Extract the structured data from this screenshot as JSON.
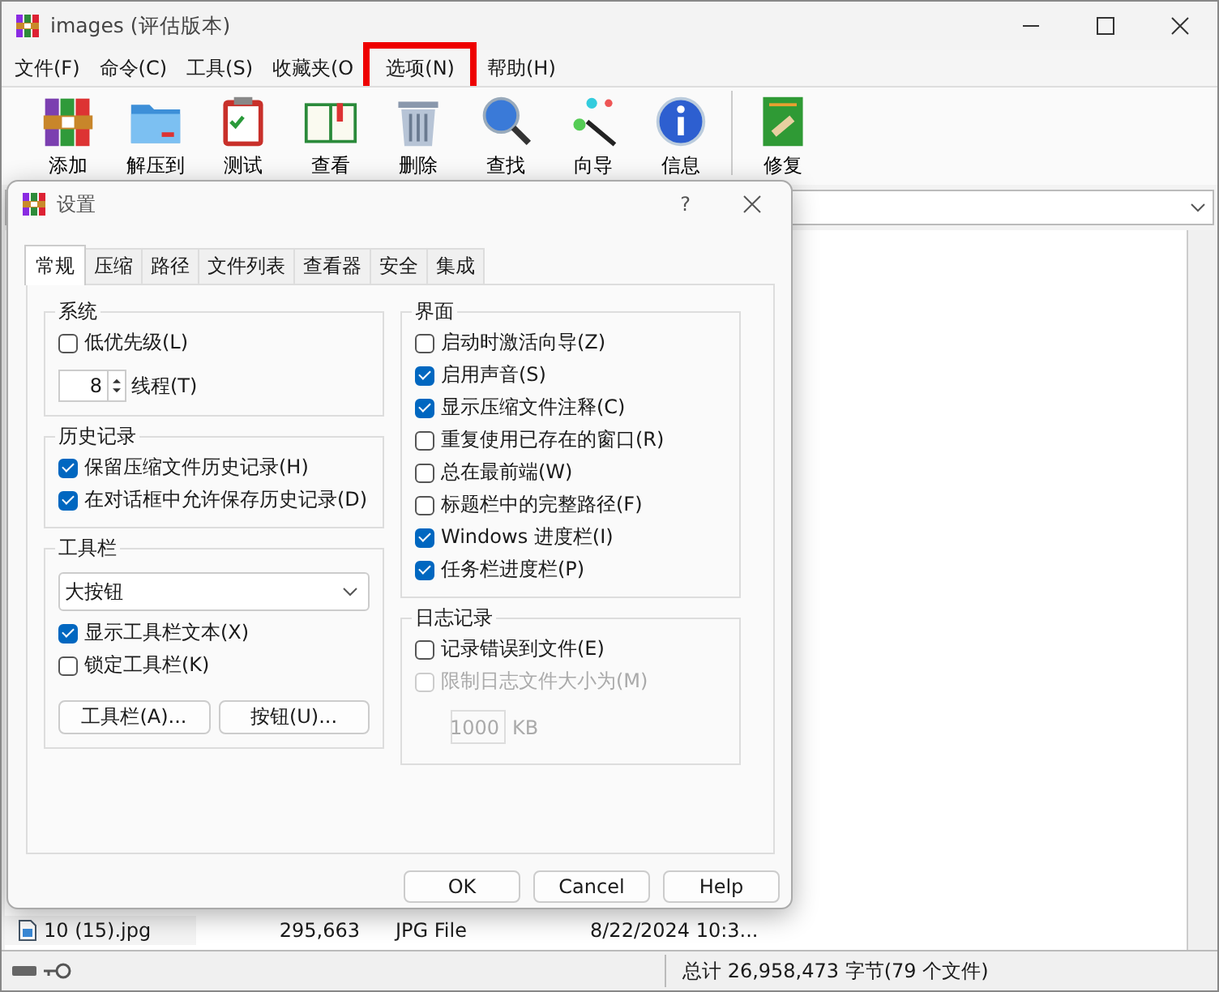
{
  "window": {
    "title": "images (评估版本)"
  },
  "menu": [
    {
      "label": "文件(F)",
      "highlighted": false
    },
    {
      "label": "命令(C)",
      "highlighted": false
    },
    {
      "label": "工具(S)",
      "highlighted": false
    },
    {
      "label": "收藏夹(O",
      "highlighted": false
    },
    {
      "label": "选项(N)",
      "highlighted": true
    },
    {
      "label": "帮助(H)",
      "highlighted": false
    }
  ],
  "toolbar": [
    {
      "label": "添加"
    },
    {
      "label": "解压到"
    },
    {
      "label": "测试"
    },
    {
      "label": "查看"
    },
    {
      "label": "删除"
    },
    {
      "label": "查找"
    },
    {
      "label": "向导"
    },
    {
      "label": "信息"
    },
    {
      "label": "修复"
    }
  ],
  "file_list": {
    "rows": [
      {
        "name": "10 (15).jpg",
        "size": "295,663",
        "type": "JPG File",
        "modified": "8/22/2024 10:3..."
      }
    ]
  },
  "status_bar": {
    "text": "总计 26,958,473 字节(79 个文件)"
  },
  "dialog": {
    "title": "设置",
    "help": "?",
    "tabs": [
      {
        "label": "常规",
        "selected": true
      },
      {
        "label": "压缩",
        "selected": false
      },
      {
        "label": "路径",
        "selected": false
      },
      {
        "label": "文件列表",
        "selected": false
      },
      {
        "label": "查看器",
        "selected": false
      },
      {
        "label": "安全",
        "selected": false
      },
      {
        "label": "集成",
        "selected": false
      }
    ],
    "left_groups": [
      {
        "title": "系统",
        "items": [
          {
            "kind": "checkbox",
            "label": "低优先级(L)",
            "checked": false,
            "disabled": false
          },
          {
            "kind": "spinner",
            "value": "8",
            "label": "线程(T)"
          }
        ]
      },
      {
        "title": "历史记录",
        "items": [
          {
            "kind": "checkbox",
            "label": "保留压缩文件历史记录(H)",
            "checked": true,
            "disabled": false
          },
          {
            "kind": "checkbox",
            "label": "在对话框中允许保存历史记录(D)",
            "checked": true,
            "disabled": false
          }
        ]
      },
      {
        "title": "工具栏",
        "items": [
          {
            "kind": "select",
            "value": "大按钮"
          },
          {
            "kind": "checkbox",
            "label": "显示工具栏文本(X)",
            "checked": true,
            "disabled": false
          },
          {
            "kind": "checkbox",
            "label": "锁定工具栏(K)",
            "checked": false,
            "disabled": false
          },
          {
            "kind": "buttons",
            "buttons": [
              "工具栏(A)...",
              "按钮(U)..."
            ]
          }
        ]
      }
    ],
    "right_groups": [
      {
        "title": "界面",
        "items": [
          {
            "kind": "checkbox",
            "label": "启动时激活向导(Z)",
            "checked": false,
            "disabled": false
          },
          {
            "kind": "checkbox",
            "label": "启用声音(S)",
            "checked": true,
            "disabled": false
          },
          {
            "kind": "checkbox",
            "label": "显示压缩文件注释(C)",
            "checked": true,
            "disabled": false
          },
          {
            "kind": "checkbox",
            "label": "重复使用已存在的窗口(R)",
            "checked": false,
            "disabled": false
          },
          {
            "kind": "checkbox",
            "label": "总在最前端(W)",
            "checked": false,
            "disabled": false
          },
          {
            "kind": "checkbox",
            "label": "标题栏中的完整路径(F)",
            "checked": false,
            "disabled": false
          },
          {
            "kind": "checkbox",
            "label": "Windows 进度栏(I)",
            "checked": true,
            "disabled": false
          },
          {
            "kind": "checkbox",
            "label": "任务栏进度栏(P)",
            "checked": true,
            "disabled": false
          }
        ]
      },
      {
        "title": "日志记录",
        "items": [
          {
            "kind": "checkbox",
            "label": "记录错误到文件(E)",
            "checked": false,
            "disabled": false
          },
          {
            "kind": "checkbox",
            "label": "限制日志文件大小为(M)",
            "checked": false,
            "disabled": true
          },
          {
            "kind": "size_field",
            "value": "1000",
            "unit": "KB",
            "disabled": true
          }
        ]
      }
    ],
    "buttons": [
      "OK",
      "Cancel",
      "Help"
    ]
  }
}
